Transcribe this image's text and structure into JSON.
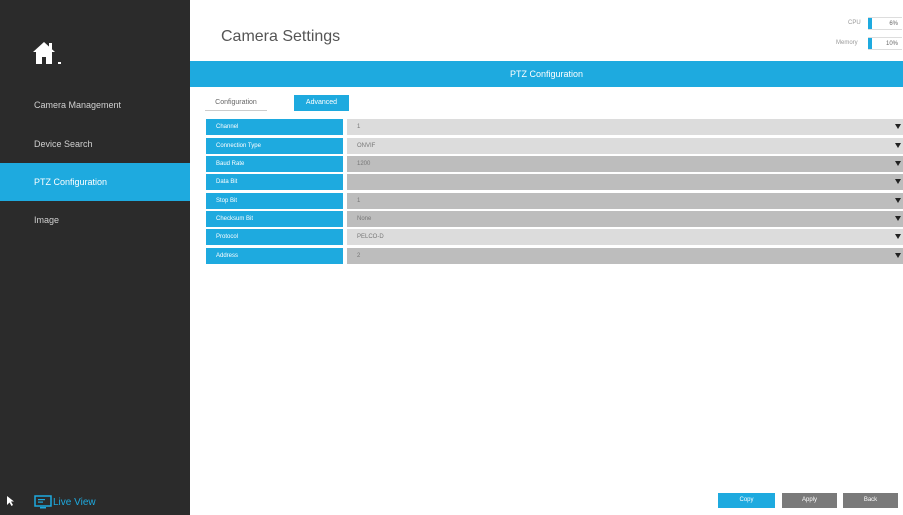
{
  "sidebar": {
    "items": [
      {
        "label": "Camera Management"
      },
      {
        "label": "Device Search"
      },
      {
        "label": "PTZ Configuration"
      },
      {
        "label": "Image"
      }
    ],
    "live_view_label": "Live View"
  },
  "header": {
    "title": "Camera Settings",
    "cpu_label": "CPU",
    "cpu_value": "6%",
    "memory_label": "Memory",
    "memory_value": "10%"
  },
  "banner": {
    "title": "PTZ Configuration"
  },
  "tabs": [
    {
      "label": "Configuration"
    },
    {
      "label": "Advanced"
    }
  ],
  "form": {
    "rows": [
      {
        "label": "Channel",
        "value": "1"
      },
      {
        "label": "Connection Type",
        "value": "ONVIF"
      },
      {
        "label": "Baud Rate",
        "value": "1200"
      },
      {
        "label": "Data Bit",
        "value": ""
      },
      {
        "label": "Stop Bit",
        "value": "1"
      },
      {
        "label": "Checksum Bit",
        "value": "None"
      },
      {
        "label": "Protocol",
        "value": "PELCO-D"
      },
      {
        "label": "Address",
        "value": "2"
      }
    ]
  },
  "buttons": {
    "copy": "Copy",
    "apply": "Apply",
    "back": "Back"
  },
  "colors": {
    "accent": "#1eaadf",
    "sidebar_bg": "#2b2b2b",
    "button_gray": "#7a7a7a"
  },
  "icons": {
    "home": "home-icon",
    "live_view": "monitor-icon",
    "cursor": "cursor-arrow-icon",
    "dropdown": "caret-down-icon"
  }
}
